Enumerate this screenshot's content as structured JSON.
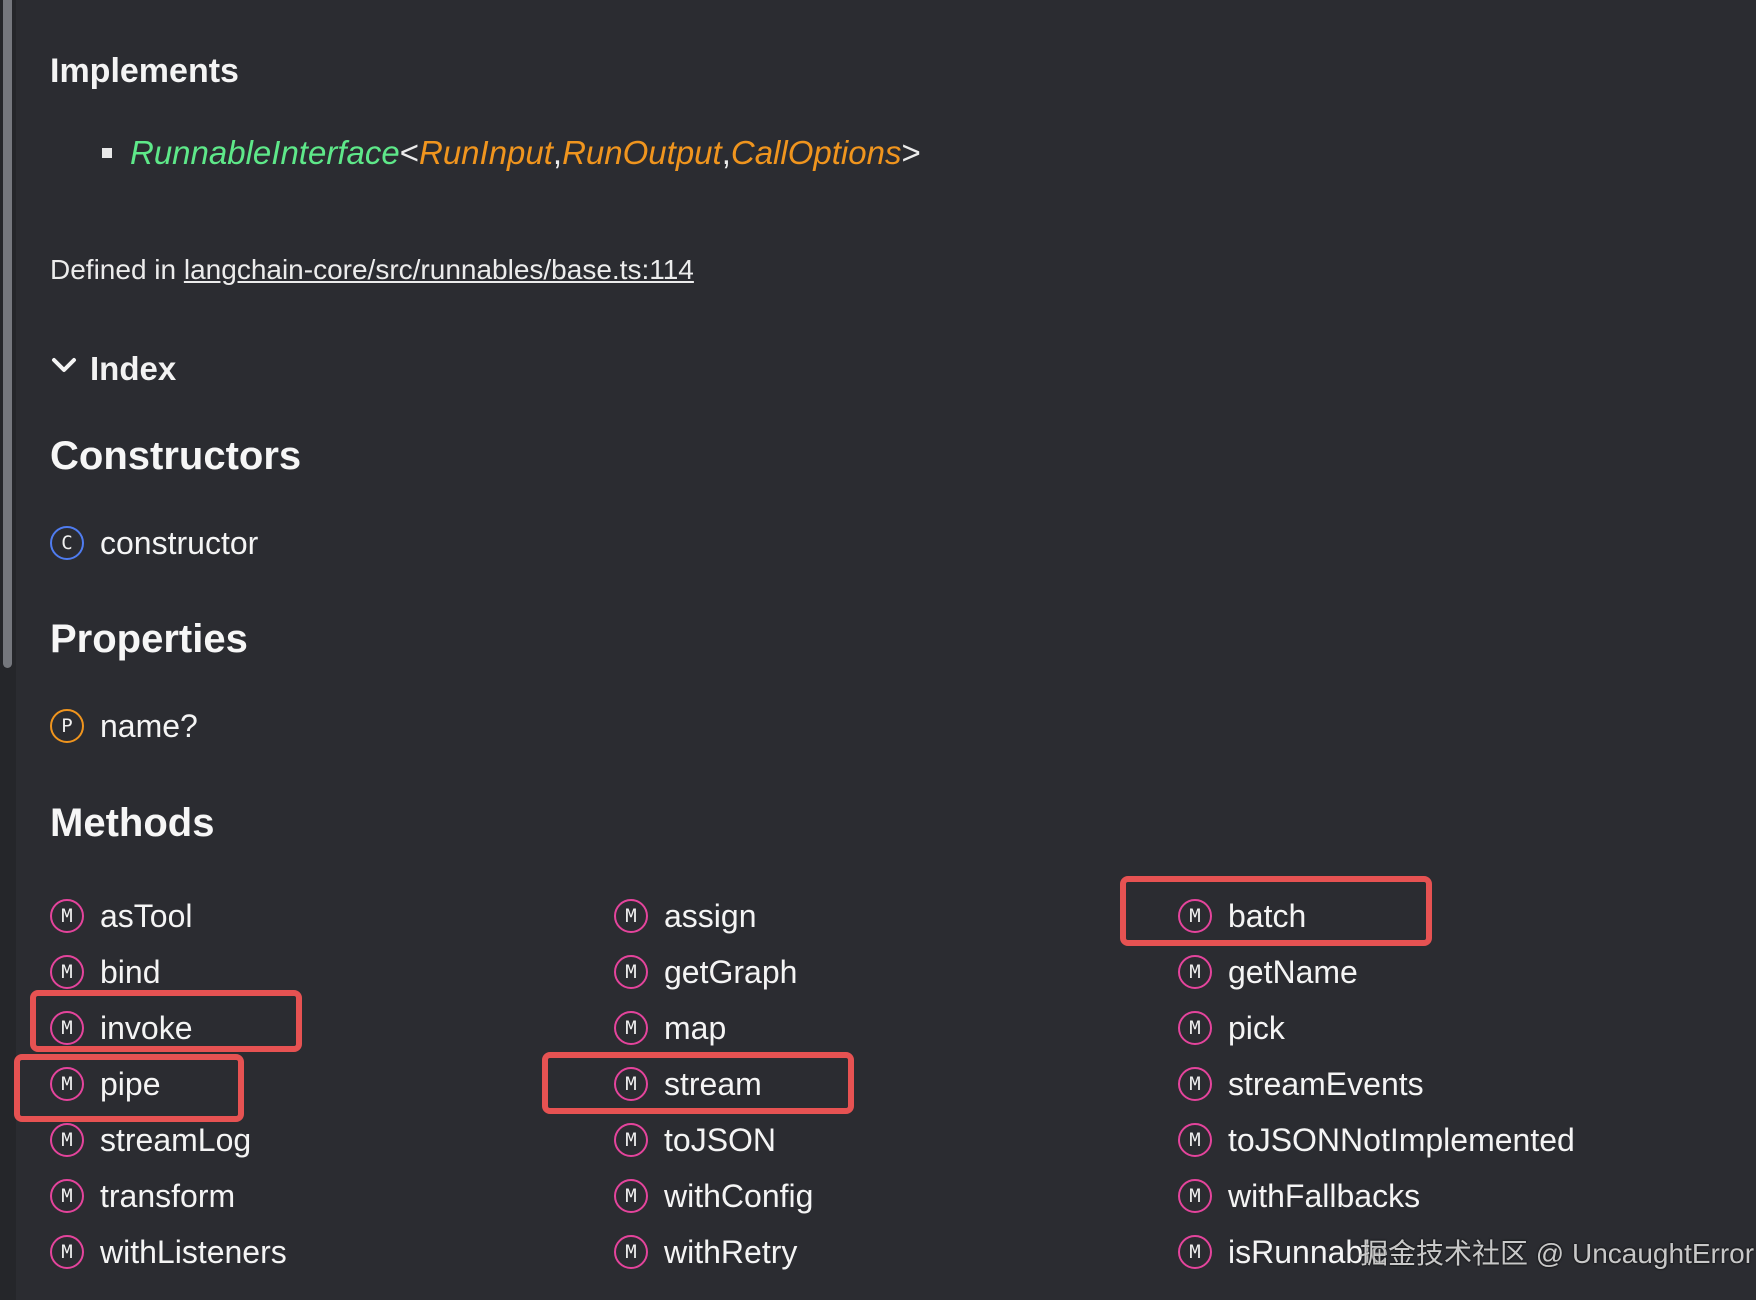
{
  "implements": {
    "heading": "Implements",
    "interface_name": "RunnableInterface",
    "open_bracket": "<",
    "type_params": [
      "RunInput",
      "RunOutput",
      "CallOptions"
    ],
    "separator": ", ",
    "close_bracket": ">"
  },
  "defined_in": {
    "prefix": "Defined in ",
    "link_text": "langchain-core/src/runnables/base.ts:114"
  },
  "index": {
    "label": "Index",
    "expanded": true
  },
  "constructors": {
    "heading": "Constructors",
    "items": [
      {
        "kind": "C",
        "label": "constructor"
      }
    ]
  },
  "properties": {
    "heading": "Properties",
    "items": [
      {
        "kind": "P",
        "label": "name?"
      }
    ]
  },
  "methods": {
    "heading": "Methods",
    "kind": "M",
    "columns": [
      [
        "asTool",
        "bind",
        "invoke",
        "pipe",
        "streamLog",
        "transform",
        "withListeners"
      ],
      [
        "assign",
        "getGraph",
        "map",
        "stream",
        "toJSON",
        "withConfig",
        "withRetry"
      ],
      [
        "batch",
        "getName",
        "pick",
        "streamEvents",
        "toJSONNotImplemented",
        "withFallbacks",
        "isRunnable"
      ]
    ],
    "highlighted": [
      "invoke",
      "pipe",
      "stream",
      "batch"
    ]
  },
  "colors": {
    "background": "#2b2c31",
    "interface": "#5ee889",
    "type_param": "#f0951e",
    "constructor_kind": "#4f7cf0",
    "property_kind": "#f0951e",
    "method_kind": "#e4449c",
    "highlight_box": "#e65252"
  },
  "watermark": "掘金技术社区 @ UncaughtError"
}
